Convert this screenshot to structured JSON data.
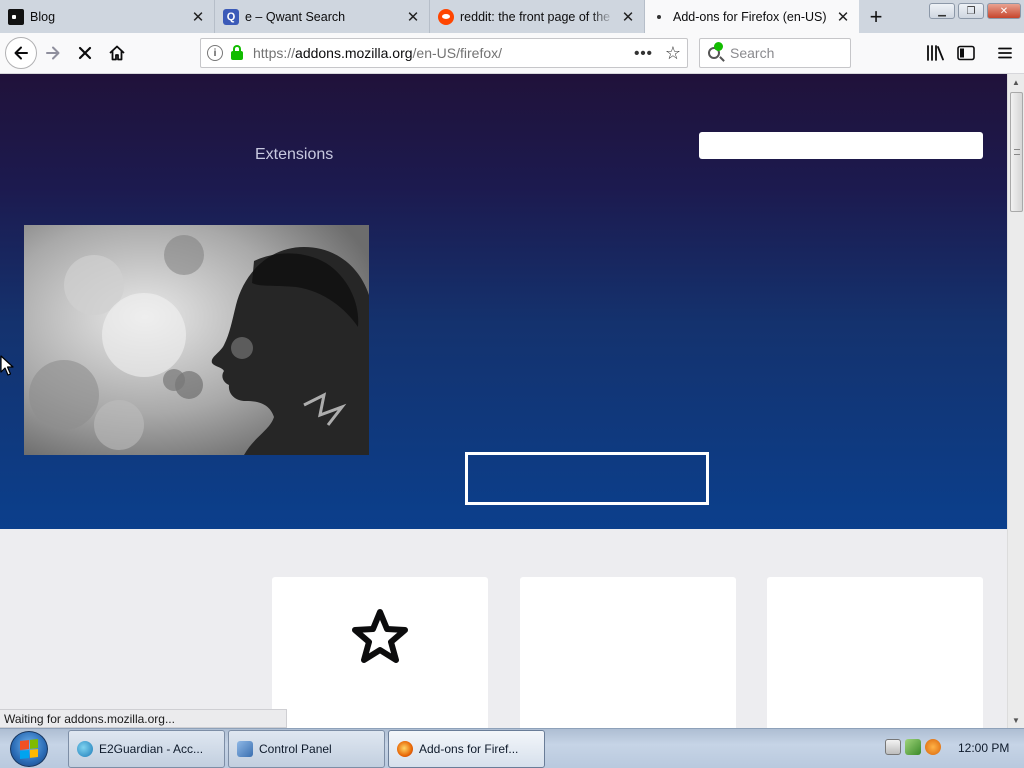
{
  "tabs": [
    {
      "title": "Blog",
      "favicon": "blog-favicon",
      "active": false
    },
    {
      "title": "e – Qwant Search",
      "favicon": "qwant-favicon",
      "active": false
    },
    {
      "title": "reddit: the front page of the internet",
      "favicon": "reddit-favicon",
      "active": false
    },
    {
      "title": "Add-ons for Firefox (en-US)",
      "favicon": "loading-dot",
      "active": true
    }
  ],
  "new_tab_symbol": "+",
  "qwant_letter": "Q",
  "navbar": {
    "url_prefix": "https://",
    "url_host": "addons.mozilla.org",
    "url_path": "/en-US/firefox/",
    "search_placeholder": "Search",
    "page_actions": "•••"
  },
  "page": {
    "nav_link": "Extensions",
    "hero_search_value": "",
    "status_text": "Waiting for addons.mozilla.org..."
  },
  "taskbar": {
    "items": [
      {
        "label": "E2Guardian - Acc...",
        "icon": "globe-icon",
        "active": false
      },
      {
        "label": "Control Panel",
        "icon": "control-panel-icon",
        "active": false
      },
      {
        "label": "Add-ons for Firef...",
        "icon": "firefox-icon",
        "active": true
      }
    ],
    "clock": "12:00 PM"
  },
  "colors": {
    "hero_top": "#20123a",
    "hero_bottom": "#0b3f8c",
    "page_bg": "#ededf0",
    "secure_green": "#12bc00"
  }
}
